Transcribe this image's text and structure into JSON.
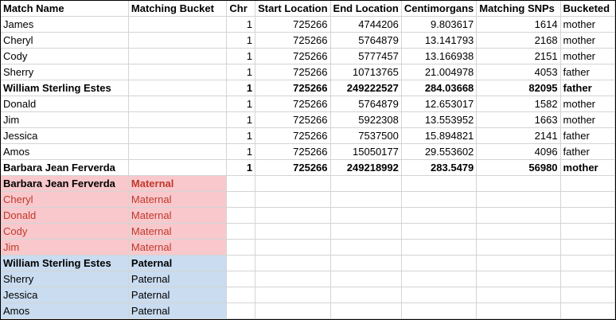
{
  "colors": {
    "maternal_fill": "#f8c8cc",
    "paternal_fill": "#c9dcf0",
    "maternal_text": "#c0392b"
  },
  "headers": [
    "Match Name",
    "Matching Bucket",
    "Chr",
    "Start Location",
    "End Location",
    "Centimorgans",
    "Matching SNPs",
    "Bucketed"
  ],
  "rows": [
    {
      "name": "James",
      "bucket": "",
      "chr": "1",
      "start": "725266",
      "end": "4744206",
      "cm": "9.803617",
      "snps": "1614",
      "bucketed": "mother"
    },
    {
      "name": "Cheryl",
      "bucket": "",
      "chr": "1",
      "start": "725266",
      "end": "5764879",
      "cm": "13.141793",
      "snps": "2168",
      "bucketed": "mother"
    },
    {
      "name": "Cody",
      "bucket": "",
      "chr": "1",
      "start": "725266",
      "end": "5777457",
      "cm": "13.166938",
      "snps": "2151",
      "bucketed": "mother"
    },
    {
      "name": "Sherry",
      "bucket": "",
      "chr": "1",
      "start": "725266",
      "end": "10713765",
      "cm": "21.004978",
      "snps": "4053",
      "bucketed": "father"
    },
    {
      "name": "William Sterling Estes",
      "bucket": "",
      "chr": "1",
      "start": "725266",
      "end": "249222527",
      "cm": "284.03668",
      "snps": "82095",
      "bucketed": "father"
    },
    {
      "name": "Donald",
      "bucket": "",
      "chr": "1",
      "start": "725266",
      "end": "5764879",
      "cm": "12.653017",
      "snps": "1582",
      "bucketed": "mother"
    },
    {
      "name": "Jim",
      "bucket": "",
      "chr": "1",
      "start": "725266",
      "end": "5922308",
      "cm": "13.553952",
      "snps": "1663",
      "bucketed": "mother"
    },
    {
      "name": "Jessica",
      "bucket": "",
      "chr": "1",
      "start": "725266",
      "end": "7537500",
      "cm": "15.894821",
      "snps": "2141",
      "bucketed": "father"
    },
    {
      "name": "Amos",
      "bucket": "",
      "chr": "1",
      "start": "725266",
      "end": "15050177",
      "cm": "29.553602",
      "snps": "4096",
      "bucketed": "father"
    },
    {
      "name": "Barbara Jean Ferverda",
      "bucket": "",
      "chr": "1",
      "start": "725266",
      "end": "249218992",
      "cm": "283.5479",
      "snps": "56980",
      "bucketed": "mother"
    }
  ],
  "maternal": [
    {
      "name": "Barbara Jean Ferverda",
      "bucket": "Maternal"
    },
    {
      "name": "Cheryl",
      "bucket": "Maternal"
    },
    {
      "name": "Donald",
      "bucket": "Maternal"
    },
    {
      "name": "Cody",
      "bucket": "Maternal"
    },
    {
      "name": "Jim",
      "bucket": "Maternal"
    }
  ],
  "paternal": [
    {
      "name": "William Sterling Estes",
      "bucket": "Paternal"
    },
    {
      "name": "Sherry",
      "bucket": "Paternal"
    },
    {
      "name": "Jessica",
      "bucket": "Paternal"
    },
    {
      "name": "Amos",
      "bucket": "Paternal"
    }
  ]
}
